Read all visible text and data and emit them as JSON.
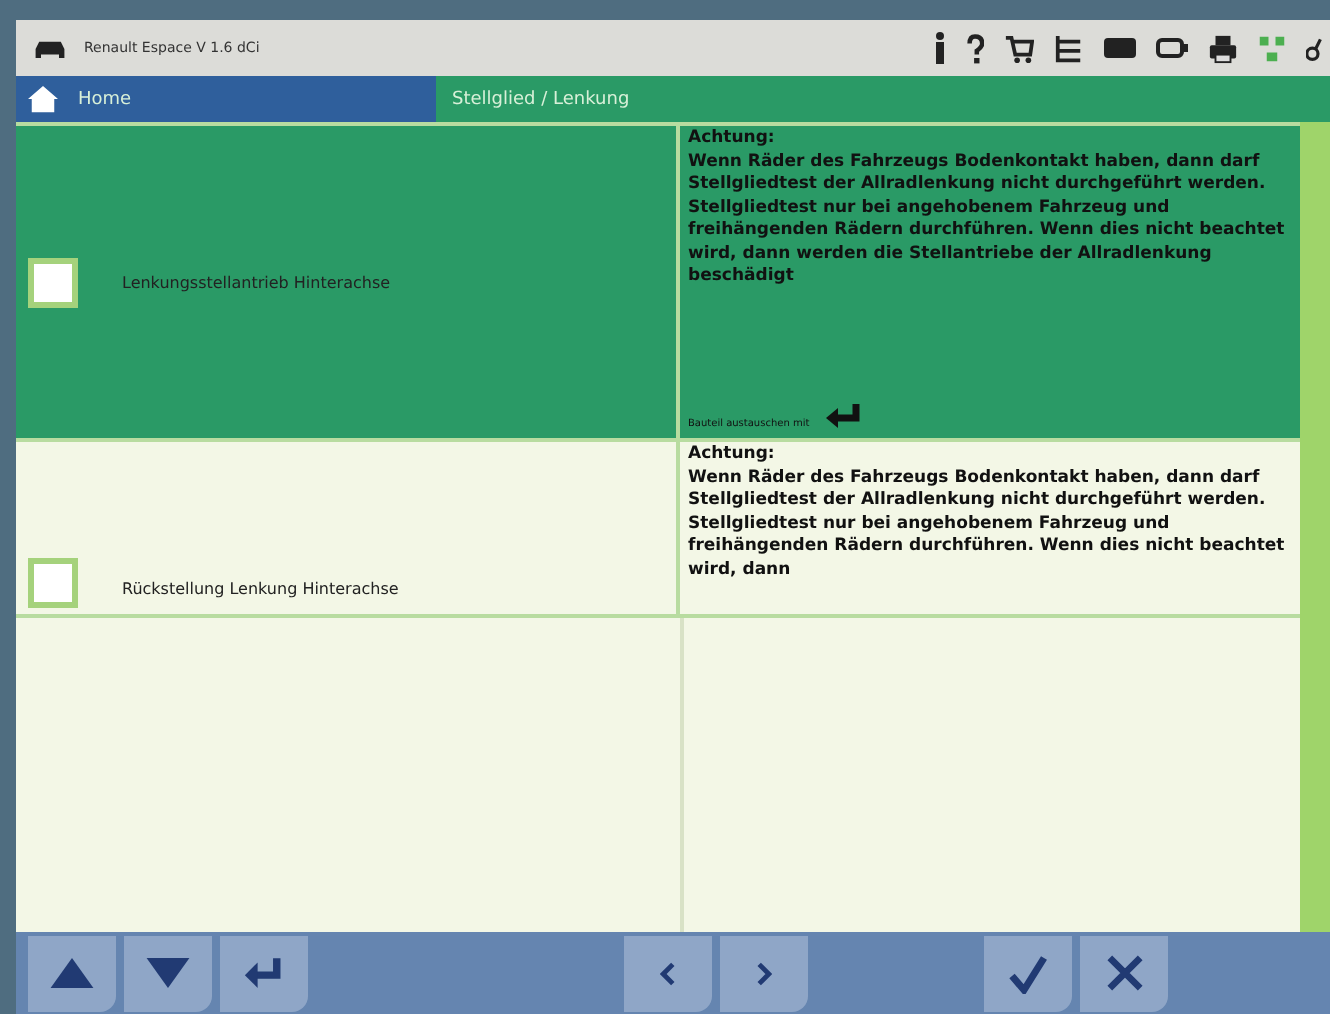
{
  "window": {
    "title": "Renault Espace V 1.6 dCi"
  },
  "breadcrumb": [
    {
      "label": "Home",
      "kind": "home"
    },
    {
      "label": "Stellglied / Lenkung",
      "kind": "page"
    }
  ],
  "rows": [
    {
      "label": "Lenkungsstellantrieb Hinterachse",
      "selected": true,
      "checked": false,
      "warning": "Achtung:\nWenn Räder des Fahrzeugs Bodenkontakt haben, dann darf Stellgliedtest der Allradlenkung nicht durchgeführt werden. Stellgliedtest nur bei angehobenem Fahrzeug und freihängenden Rädern durchführen. Wenn dies nicht beachtet wird, dann werden die Stellantriebe der Allradlenkung beschädigt",
      "hint": "Bauteil austauschen mit"
    },
    {
      "label": "Rückstellung Lenkung Hinterachse",
      "selected": false,
      "checked": false,
      "warning": "Achtung:\nWenn Räder des Fahrzeugs Bodenkontakt haben, dann darf Stellgliedtest der Allradlenkung nicht durchgeführt werden. Stellgliedtest nur bei angehobenem Fahrzeug und freihängenden Rädern durchführen. Wenn dies nicht beachtet wird, dann"
    }
  ]
}
